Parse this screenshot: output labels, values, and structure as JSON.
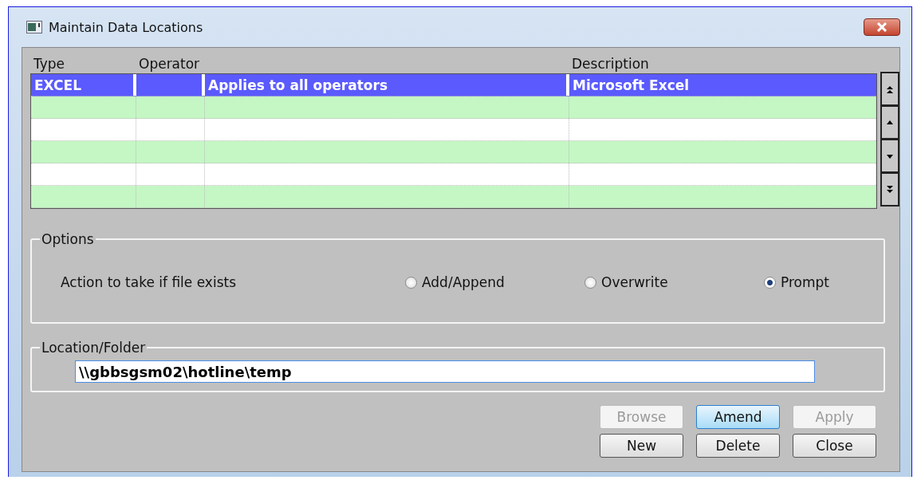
{
  "window": {
    "title": "Maintain Data Locations"
  },
  "table": {
    "columns": [
      {
        "label": "Type"
      },
      {
        "label": "Operator"
      },
      {
        "label": "Description"
      }
    ],
    "rows": [
      {
        "type": "EXCEL",
        "operator_description": "Applies to all operators",
        "description": "Microsoft Excel",
        "selected": true
      },
      {
        "selected": false
      },
      {
        "selected": false
      },
      {
        "selected": false
      },
      {
        "selected": false
      },
      {
        "selected": false
      }
    ]
  },
  "options": {
    "title": "Options",
    "label": "Action to take if file exists",
    "choices": [
      {
        "label": "Add/Append",
        "selected": false
      },
      {
        "label": "Overwrite",
        "selected": false
      },
      {
        "label": "Prompt",
        "selected": true
      }
    ]
  },
  "location": {
    "title": "Location/Folder",
    "value": "\\\\gbbsgsm02\\hotline\\temp"
  },
  "buttons": [
    {
      "label": "Browse",
      "disabled": true,
      "focused": false
    },
    {
      "label": "Amend",
      "disabled": false,
      "focused": true
    },
    {
      "label": "Apply",
      "disabled": true,
      "focused": false
    },
    {
      "label": "New",
      "disabled": false,
      "focused": false
    },
    {
      "label": "Delete",
      "disabled": false,
      "focused": false
    },
    {
      "label": "Close",
      "disabled": false,
      "focused": false
    }
  ]
}
